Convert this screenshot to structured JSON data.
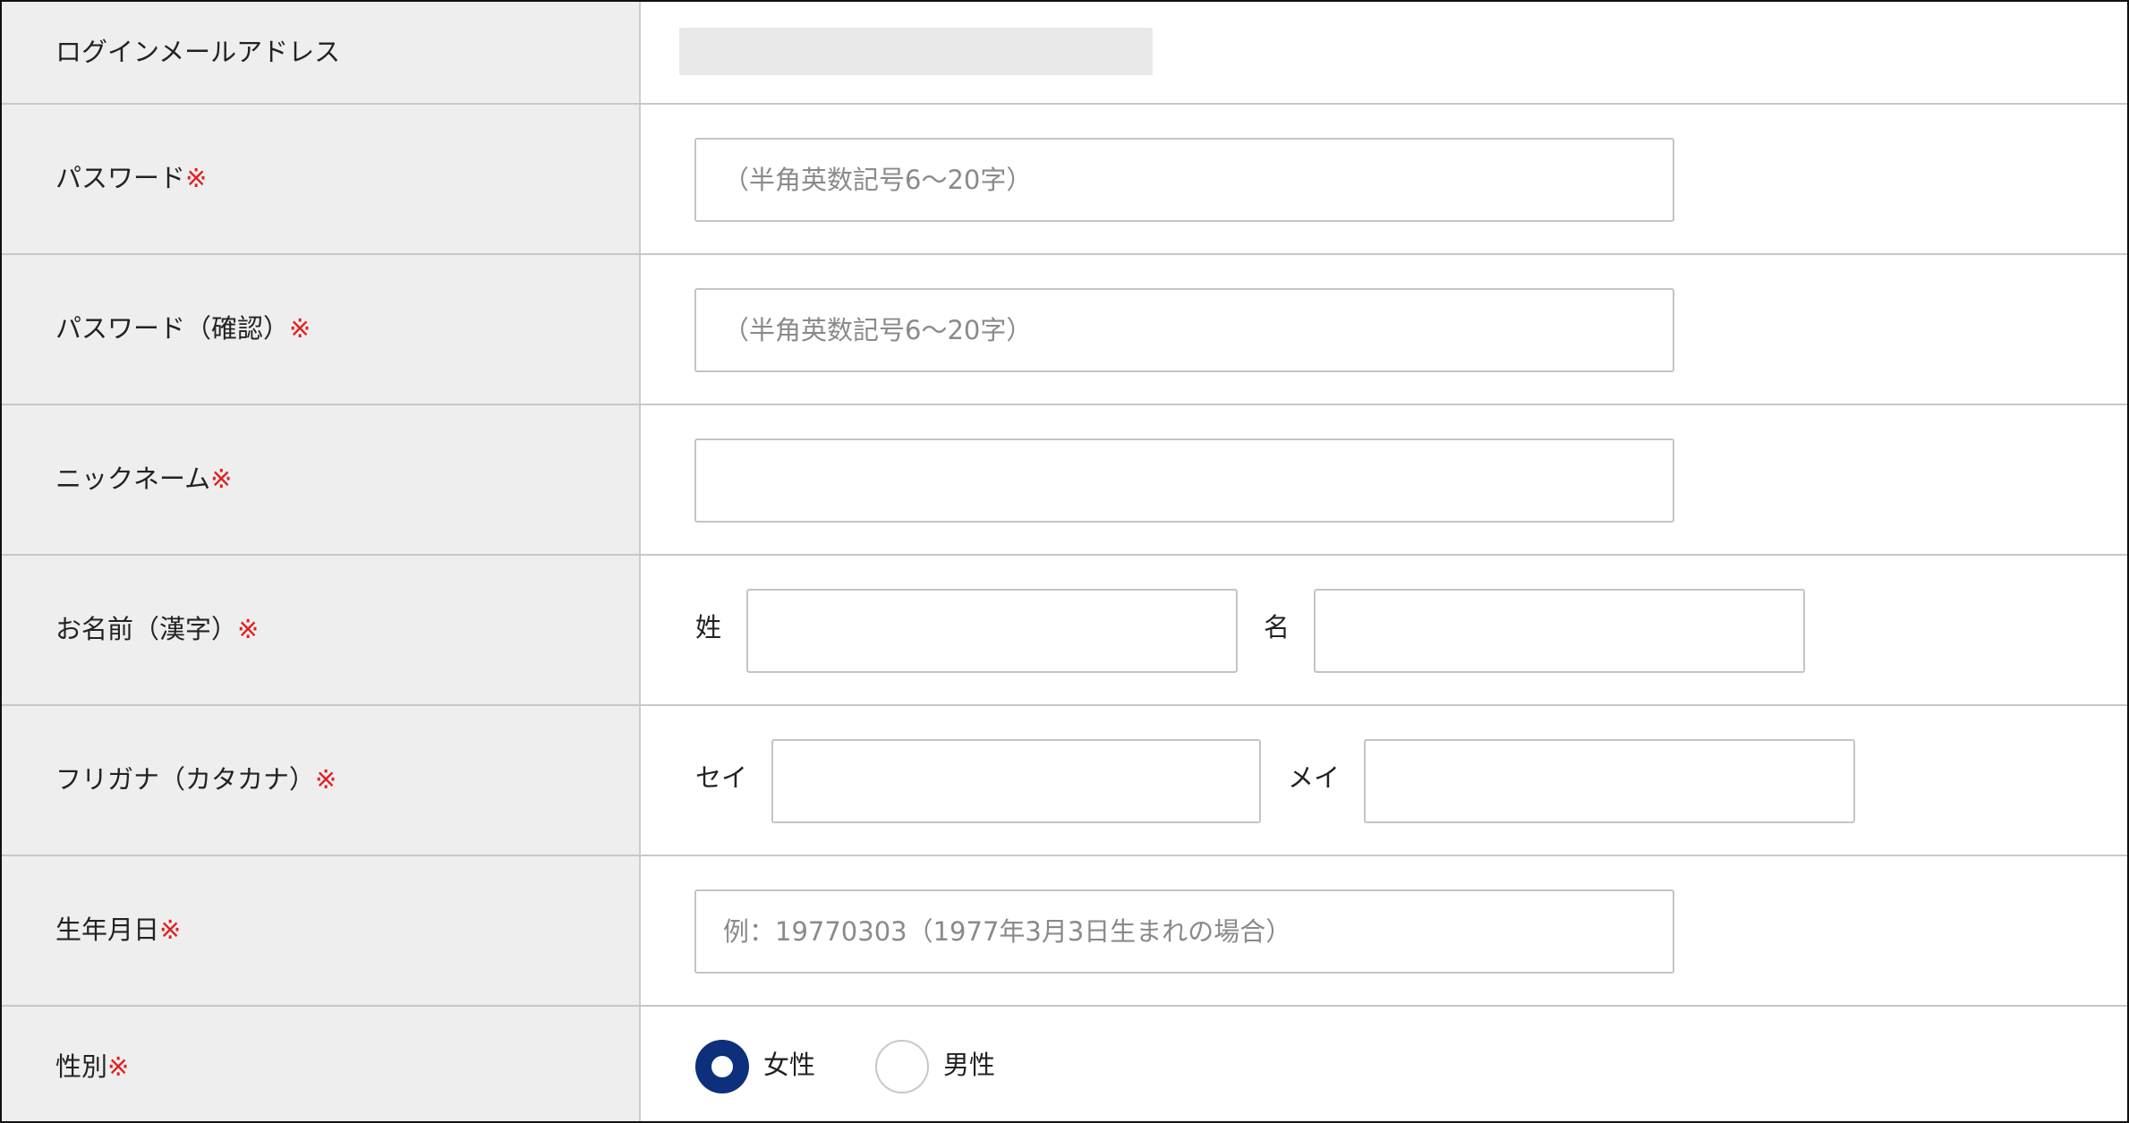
{
  "form": {
    "required_mark": "※",
    "rows": {
      "email": {
        "label": "ログインメールアドレス"
      },
      "password": {
        "label": "パスワード",
        "placeholder": "（半角英数記号6〜20字）"
      },
      "password_confirm": {
        "label": "パスワード（確認）",
        "placeholder": "（半角英数記号6〜20字）"
      },
      "nickname": {
        "label": "ニックネーム",
        "value": ""
      },
      "name_kanji": {
        "label": "お名前（漢字）",
        "last_label": "姓",
        "first_label": "名",
        "last_value": "",
        "first_value": ""
      },
      "name_kana": {
        "label": "フリガナ（カタカナ）",
        "last_label": "セイ",
        "first_label": "メイ",
        "last_value": "",
        "first_value": ""
      },
      "birthdate": {
        "label": "生年月日",
        "placeholder": "例：19770303（1977年3月3日生まれの場合）"
      },
      "gender": {
        "label": "性別",
        "options": [
          "女性",
          "男性"
        ],
        "selected": "女性"
      }
    }
  },
  "colors": {
    "required": "#e02020",
    "radio_selected": "#0d2f7c",
    "label_bg": "#eeeeee"
  }
}
